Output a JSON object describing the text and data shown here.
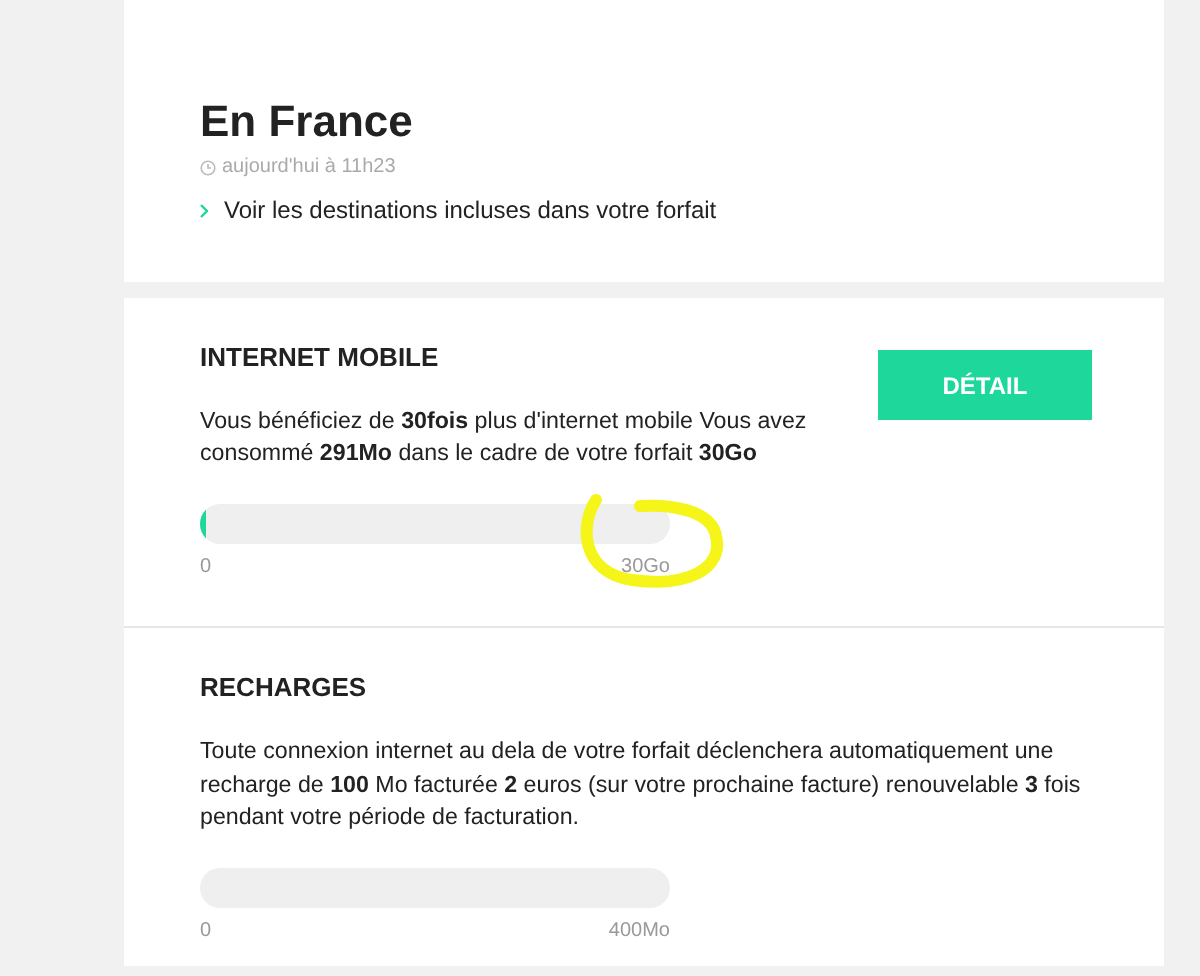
{
  "header": {
    "title": "En France",
    "timestamp": "aujourd'hui à 11h23",
    "link": "Voir les destinations incluses dans votre forfait"
  },
  "sections": [
    {
      "title": "INTERNET MOBILE",
      "button": "DÉTAIL",
      "text": "Vous bénéficiez de **30fois** plus d'internet mobile Vous avez consommé **291Mo** dans le cadre de votre forfait **30Go**",
      "level": 0.012,
      "min_label": "0",
      "max_label": "30Go"
    },
    {
      "title": "RECHARGES",
      "text": "Toute connexion internet au dela de votre forfait déclenchera automatiquement une recharge de **100** Mo facturée **2** euros (sur votre prochaine facture) renouvelable **3** fois pendant votre période de facturation.",
      "min_label": "0",
      "max_label": "400Mo"
    }
  ]
}
